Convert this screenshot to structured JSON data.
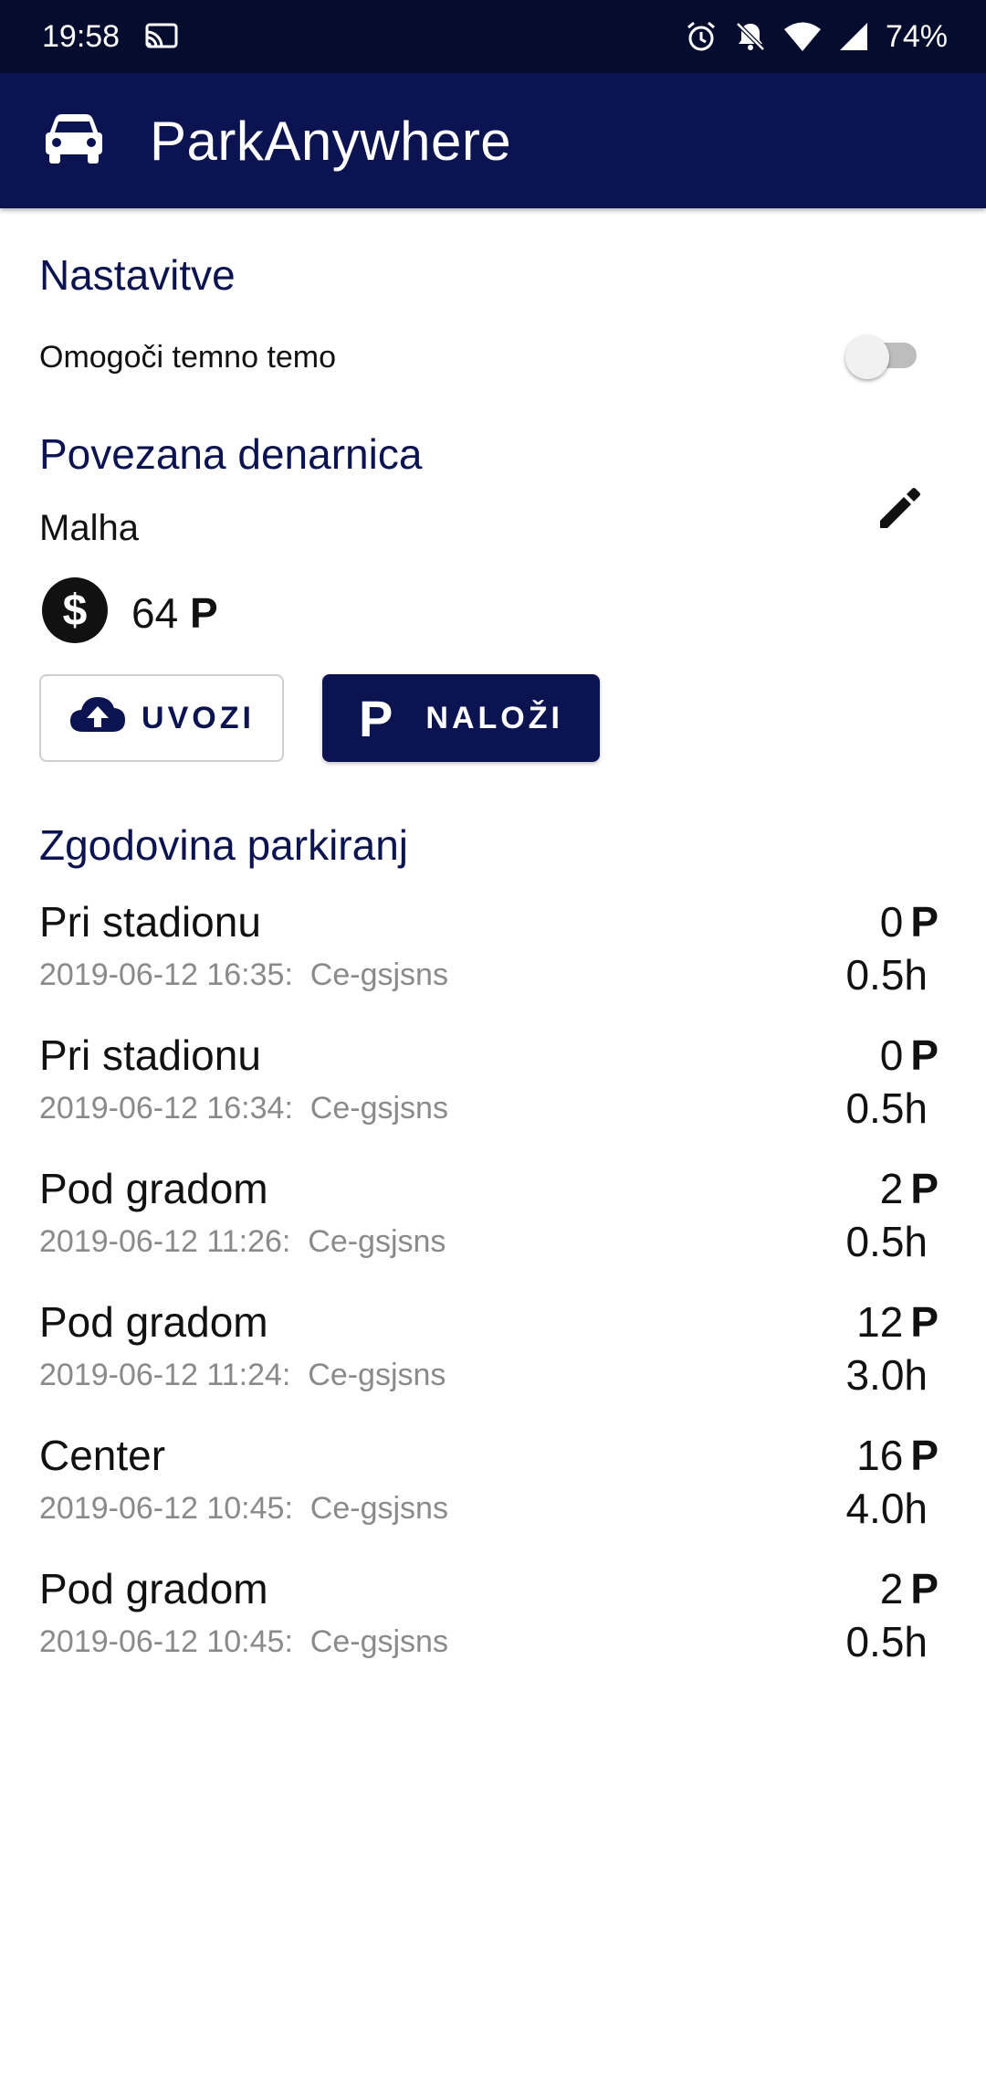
{
  "status_bar": {
    "time": "19:58",
    "battery": "74%",
    "icons": [
      "cast-icon",
      "alarm-icon",
      "notifications-off-icon",
      "wifi-icon",
      "signal-icon"
    ]
  },
  "app_bar": {
    "title": "ParkAnywhere",
    "icon": "car-icon",
    "color": "#0b1450"
  },
  "settings": {
    "title": "Nastavitve",
    "dark_theme_label": "Omogoči temno temo",
    "dark_theme_enabled": false
  },
  "wallet": {
    "title": "Povezana denarnica",
    "name": "Malha",
    "balance": "64",
    "currency_symbol": "P",
    "import_label": "UVOZI",
    "upload_label": "NALOŽI",
    "upload_icon_text": "P"
  },
  "history": {
    "title": "Zgodovina parkiranj",
    "items": [
      {
        "location": "Pri stadionu",
        "meta": "2019-06-12 16:35:  Ce-gsjsns",
        "cost": "0",
        "symbol": "P",
        "duration": "0.5h"
      },
      {
        "location": "Pri stadionu",
        "meta": "2019-06-12 16:34:  Ce-gsjsns",
        "cost": "0",
        "symbol": "P",
        "duration": "0.5h"
      },
      {
        "location": "Pod gradom",
        "meta": "2019-06-12 11:26:  Ce-gsjsns",
        "cost": "2",
        "symbol": "P",
        "duration": "0.5h"
      },
      {
        "location": "Pod gradom",
        "meta": "2019-06-12 11:24:  Ce-gsjsns",
        "cost": "12",
        "symbol": "P",
        "duration": "3.0h"
      },
      {
        "location": "Center",
        "meta": "2019-06-12 10:45:  Ce-gsjsns",
        "cost": "16",
        "symbol": "P",
        "duration": "4.0h"
      },
      {
        "location": "Pod gradom",
        "meta": "2019-06-12 10:45:  Ce-gsjsns",
        "cost": "2",
        "symbol": "P",
        "duration": "0.5h"
      }
    ]
  }
}
